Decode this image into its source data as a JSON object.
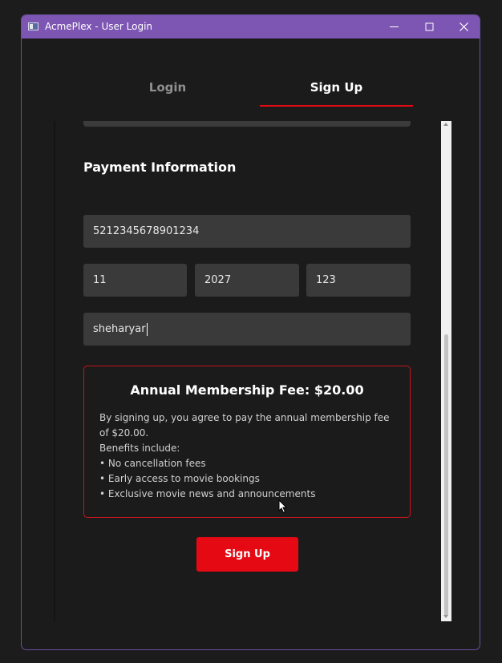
{
  "window": {
    "title": "AcmePlex - User Login"
  },
  "tabs": {
    "login_label": "Login",
    "signup_label": "Sign Up",
    "active": "Sign Up"
  },
  "payment": {
    "section_title": "Payment Information",
    "card_number": "5212345678901234",
    "expiry_month": "11",
    "expiry_year": "2027",
    "cvv": "123",
    "cardholder_name": "sheharyar"
  },
  "fee": {
    "title": "Annual Membership Fee: $20.00",
    "lines": [
      "By signing up, you agree to pay the annual membership fee of $20.00.",
      "Benefits include:",
      "• No cancellation fees",
      "• Early access to movie bookings",
      "• Exclusive movie news and announcements"
    ]
  },
  "actions": {
    "signup_button": "Sign Up"
  },
  "colors": {
    "accent": "#e50914",
    "titlebar": "#7d56b3",
    "background": "#1b1b1b",
    "field": "#3a3a3a"
  }
}
